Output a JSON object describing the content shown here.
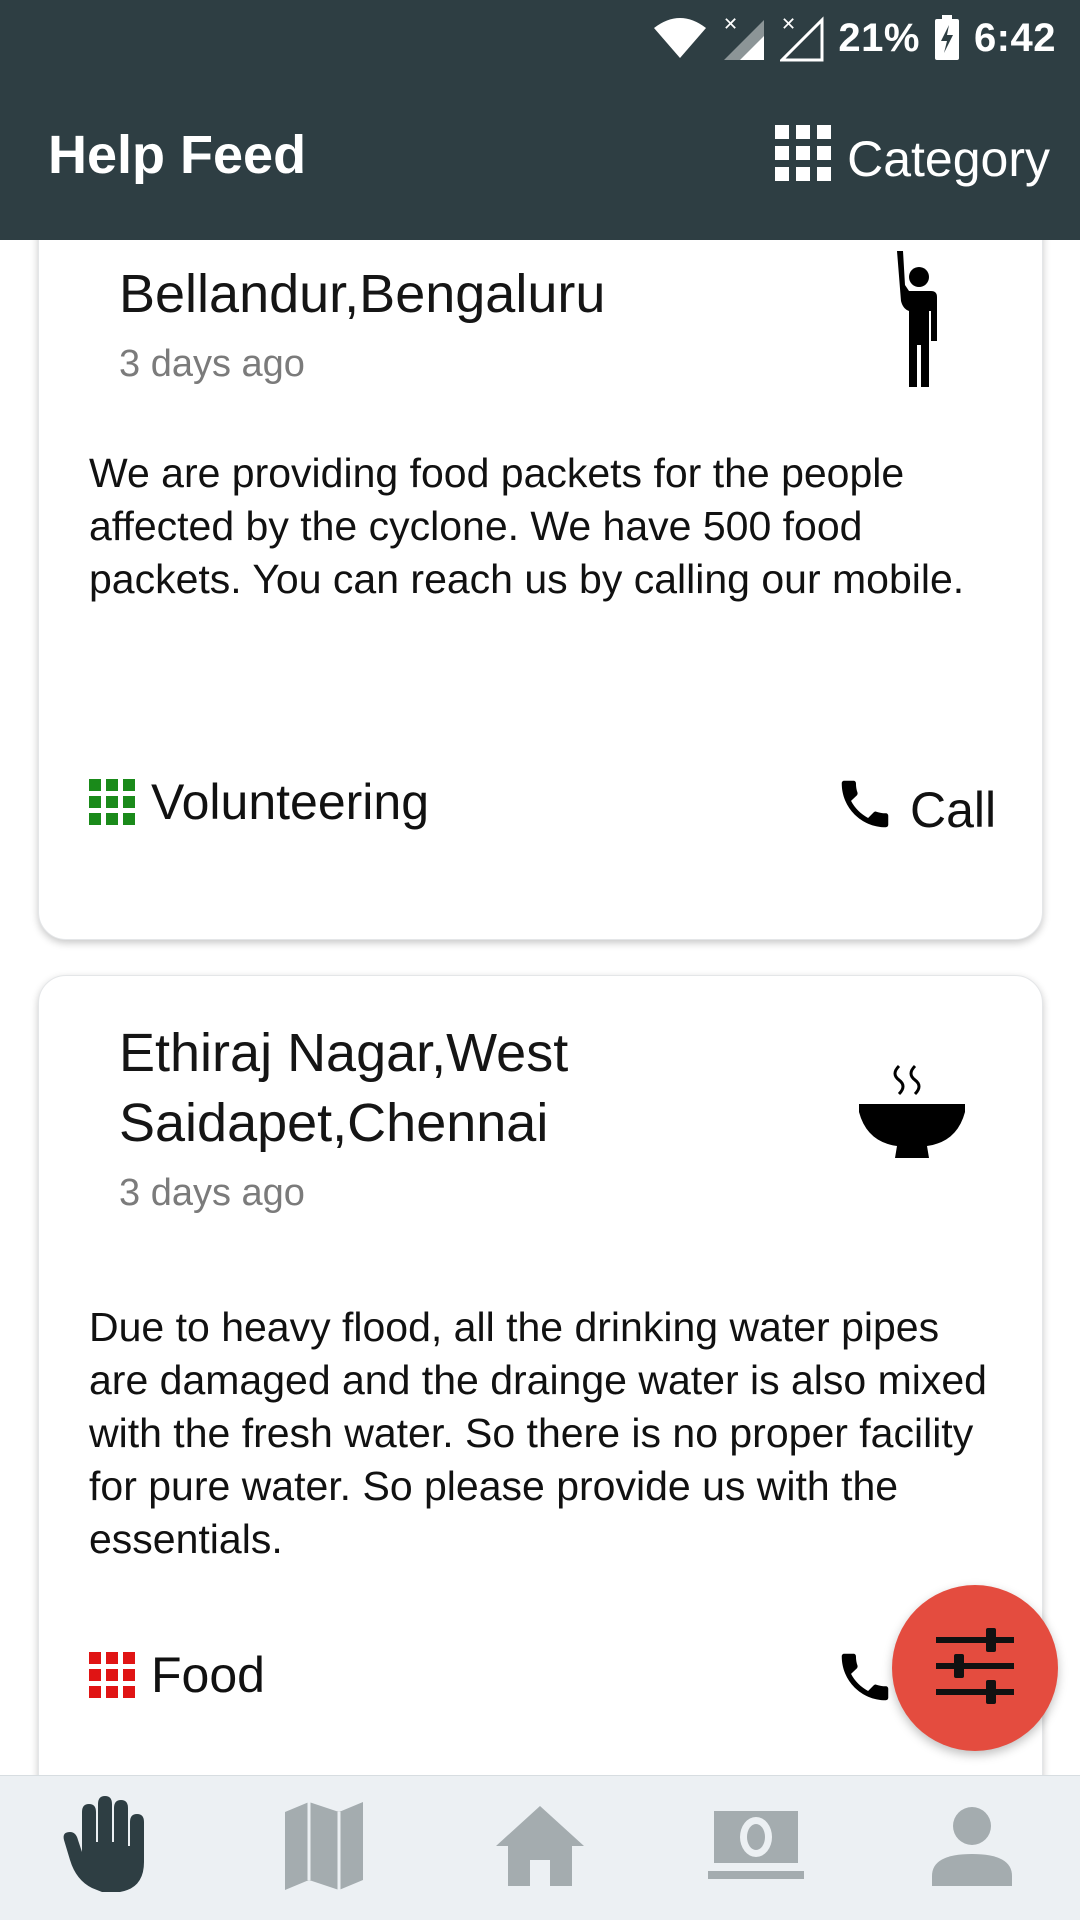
{
  "status_bar": {
    "battery": "21%",
    "time": "6:42",
    "icons": [
      "wifi-icon",
      "signal-1-icon",
      "signal-2-icon",
      "battery-charging-icon"
    ]
  },
  "header": {
    "title": "Help Feed",
    "category_label": "Category",
    "category_icon": "grid-icon",
    "background": "#2e3e43"
  },
  "feed": {
    "cards": [
      {
        "location": "Bellandur,Bengaluru",
        "time_ago": "3 days ago",
        "icon": "person-raising-hand-icon",
        "description": "We are providing food packets for the people affected by the cyclone. We have 500 food packets. You can reach us by calling our mobile.",
        "category": "Volunteering",
        "category_color": "#1a8a1a",
        "call_label": "Call"
      },
      {
        "location": "Ethiraj Nagar,West Saidapet,Chennai",
        "location_line1": "Ethiraj Nagar,West",
        "location_line2": "Saidapet,Chennai",
        "time_ago": "3 days ago",
        "icon": "hot-bowl-icon",
        "description": "Due to heavy flood, all the drinking water pipes are damaged and the drainge water is also mixed with the fresh water. So there is no proper facility for pure water. So please provide us with the essentials.",
        "category": "Food",
        "category_color": "#e01414"
      }
    ]
  },
  "fab": {
    "icon": "filter-sliders-icon",
    "color": "#e44c3f"
  },
  "bottom_nav": {
    "items": [
      {
        "icon": "hand-icon",
        "active": true
      },
      {
        "icon": "map-icon",
        "active": false
      },
      {
        "icon": "home-icon",
        "active": false
      },
      {
        "icon": "money-icon",
        "active": false
      },
      {
        "icon": "profile-icon",
        "active": false
      }
    ],
    "active_color": "#2e3e43",
    "inactive_color": "#a4acaf"
  }
}
